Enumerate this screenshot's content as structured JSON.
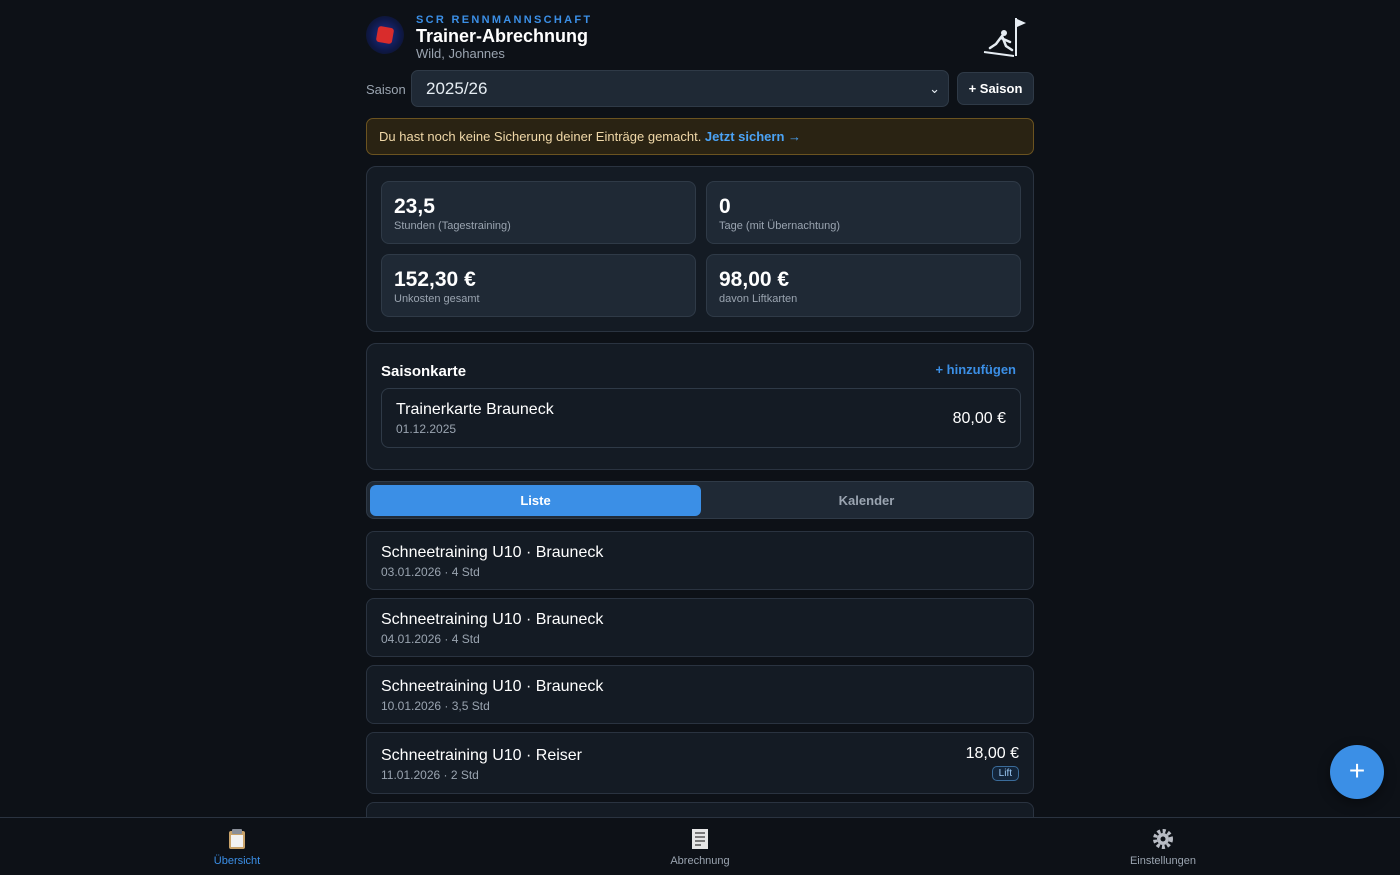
{
  "header": {
    "brand": "SCR RENNMANNSCHAFT",
    "title": "Trainer-Abrechnung",
    "user": "Wild, Johannes"
  },
  "season": {
    "label": "Saison",
    "selected": "2025/26",
    "add_label": "+ Saison"
  },
  "warning": {
    "text": "Du hast noch keine Sicherung deiner Einträge gemacht. ",
    "link": "Jetzt sichern →"
  },
  "stats": [
    {
      "value": "23,5",
      "label": "Stunden (Tagestraining)"
    },
    {
      "value": "0",
      "label": "Tage (mit Übernachtung)"
    },
    {
      "value": "152,30 €",
      "label": "Unkosten gesamt"
    },
    {
      "value": "98,00 €",
      "label": "davon Liftkarten"
    }
  ],
  "season_card": {
    "title": "Saisonkarte",
    "add_label": "+ hinzufügen",
    "item": {
      "name": "Trainerkarte Brauneck",
      "date": "01.12.2025",
      "price": "80,00 €"
    }
  },
  "tabs": {
    "list": "Liste",
    "calendar": "Kalender"
  },
  "entries": [
    {
      "title": "Schneetraining U10 · Brauneck",
      "meta": "03.01.2026 · 4 Std"
    },
    {
      "title": "Schneetraining U10 · Brauneck",
      "meta": "04.01.2026 · 4 Std"
    },
    {
      "title": "Schneetraining U10 · Brauneck",
      "meta": "10.01.2026 · 3,5 Std"
    },
    {
      "title": "Schneetraining U10 · Reiser",
      "meta": "11.01.2026 · 2 Std",
      "amount": "18,00 €",
      "badge": "Lift"
    }
  ],
  "fab": {
    "label": "+"
  },
  "nav": {
    "overview": "Übersicht",
    "billing": "Abrechnung",
    "settings": "Einstellungen"
  },
  "colors": {
    "background": "#0d1117",
    "accent": "#3b8fe6",
    "warning_bg": "#2a2313"
  }
}
